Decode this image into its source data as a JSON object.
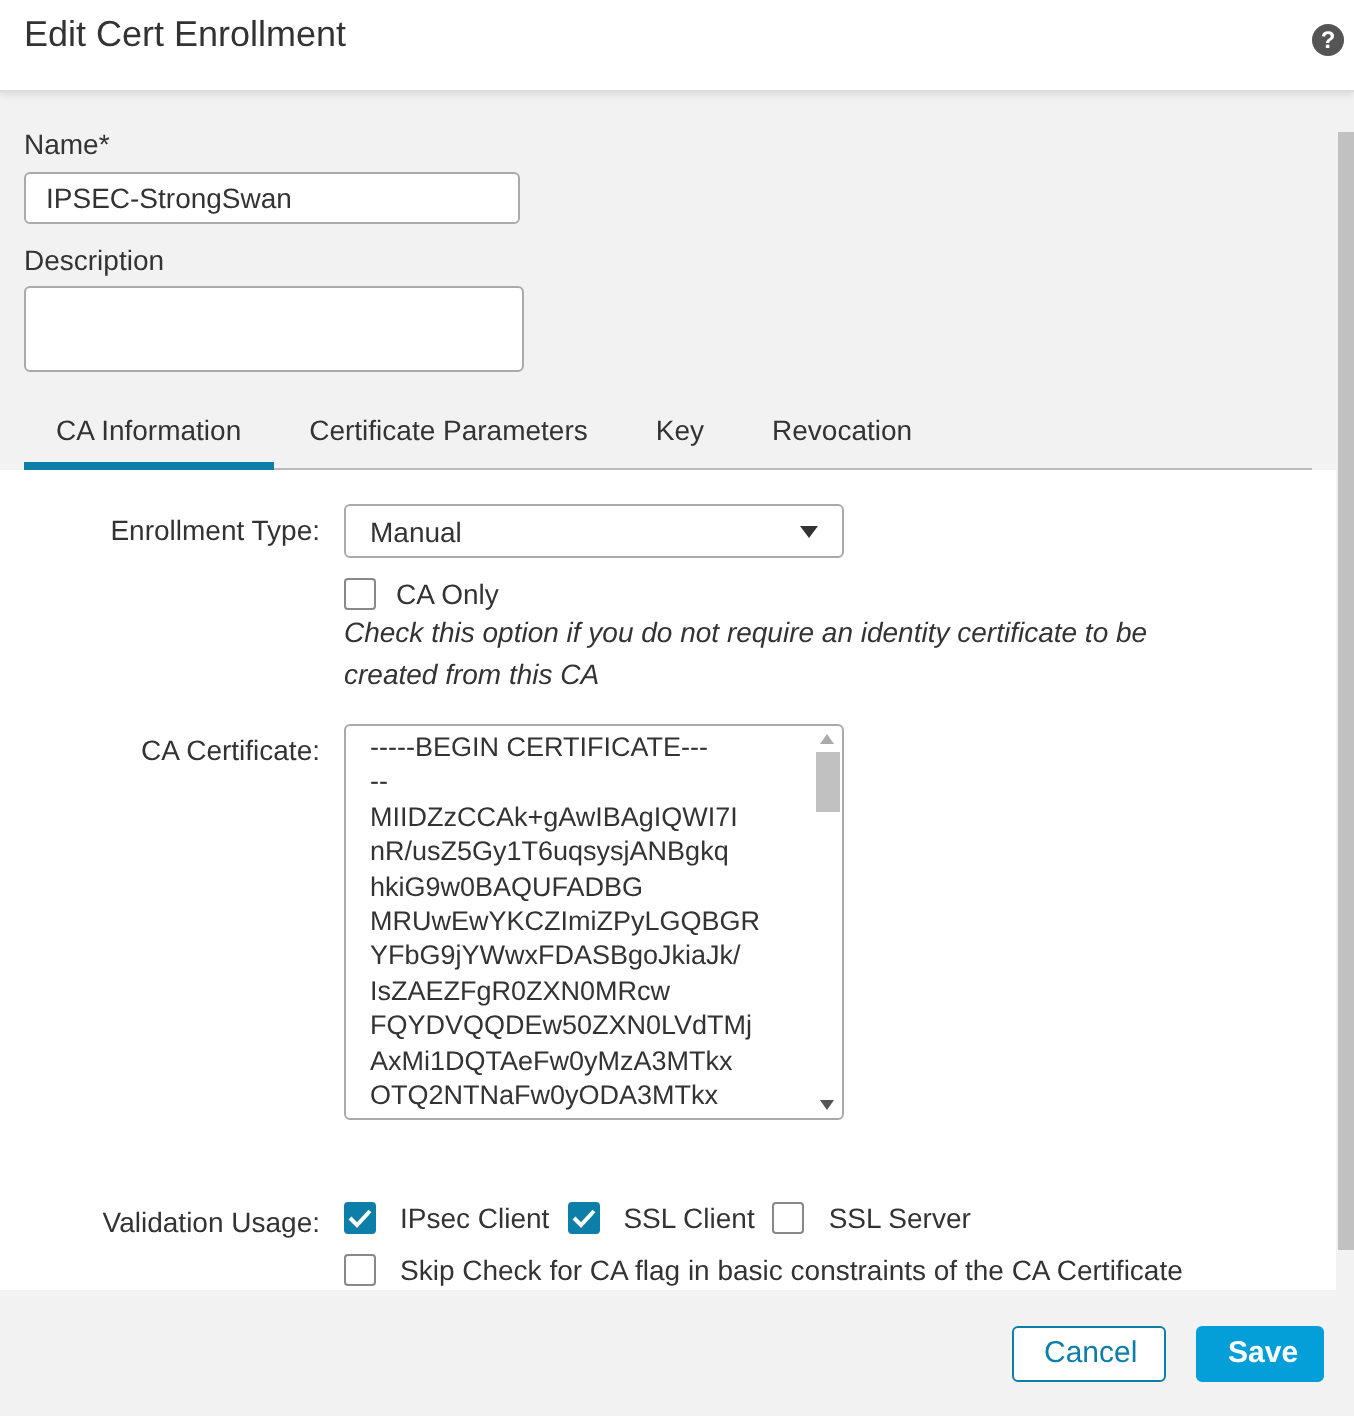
{
  "dialog": {
    "title": "Edit Cert Enrollment",
    "help": "?"
  },
  "name": {
    "label": "Name*",
    "value": "IPSEC-StrongSwan"
  },
  "description": {
    "label": "Description"
  },
  "tabs": [
    {
      "label": "CA Information",
      "selected": true
    },
    {
      "label": "Certificate Parameters",
      "selected": false
    },
    {
      "label": "Key",
      "selected": false
    },
    {
      "label": "Revocation",
      "selected": false
    }
  ],
  "enrollment_type": {
    "label": "Enrollment Type:",
    "value": "Manual"
  },
  "ca_only": {
    "label": "CA Only",
    "checked": false,
    "hint": "Check this option if you do not require an identity certificate to be created from this CA"
  },
  "ca_certificate": {
    "label": "CA Certificate:",
    "lines": [
      "-----BEGIN CERTIFICATE---",
      "--",
      "MIIDZzCCAk+gAwIBAgIQWI7I",
      "nR/usZ5Gy1T6uqsysjANBgkq",
      "hkiG9w0BAQUFADBG",
      "MRUwEwYKCZImiZPyLGQBGR",
      "YFbG9jYWwxFDASBgoJkiaJk/",
      "IsZAEZFgR0ZXN0MRcw",
      "FQYDVQQDEw50ZXN0LVdTMj",
      "AxMi1DQTAeFw0yMzA3MTkx",
      "OTQ2NTNaFw0yODA3MTkx"
    ]
  },
  "validation_usage": {
    "label": "Validation Usage:",
    "options": [
      {
        "label": "IPsec Client",
        "checked": true
      },
      {
        "label": "SSL Client",
        "checked": true
      },
      {
        "label": "SSL Server",
        "checked": false
      }
    ]
  },
  "skip_check": {
    "label": "Skip Check for CA flag in basic constraints of the CA Certificate",
    "checked": false
  },
  "buttons": [
    {
      "label": "Cancel",
      "kind": "secondary"
    },
    {
      "label": "Save",
      "kind": "primary"
    }
  ]
}
